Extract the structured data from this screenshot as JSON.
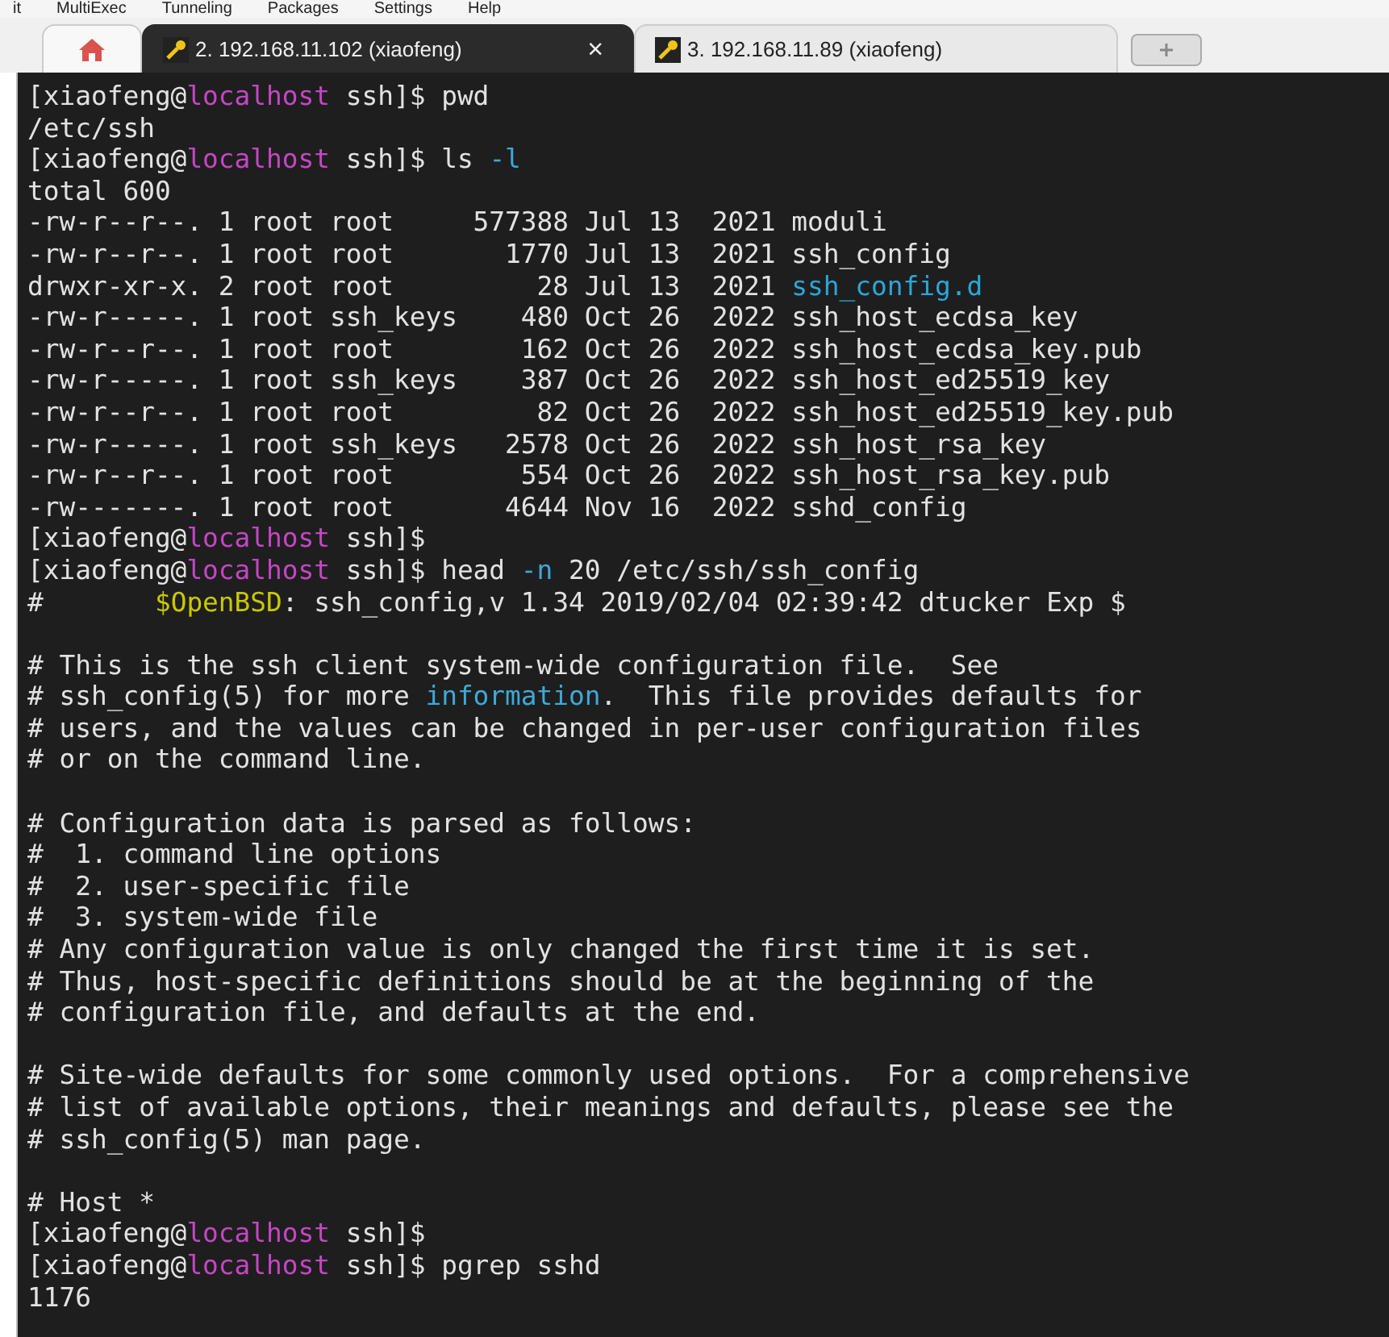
{
  "menu": [
    "it",
    "MultiExec",
    "Tunneling",
    "Packages",
    "Settings",
    "Help"
  ],
  "tabs": [
    {
      "kind": "home",
      "selected": false
    },
    {
      "kind": "session",
      "label": "2. 192.168.11.102 (xiaofeng)",
      "selected": true,
      "close": "×"
    },
    {
      "kind": "session",
      "label": "3. 192.168.11.89 (xiaofeng)",
      "selected": false
    },
    {
      "kind": "new",
      "selected": false
    }
  ],
  "terminal": {
    "lines": [
      {
        "segments": [
          {
            "text": "[xiaofeng@"
          },
          {
            "text": "localhost",
            "color": "#c546c5"
          },
          {
            "text": " ssh]$ pwd"
          }
        ]
      },
      {
        "segments": [
          {
            "text": "/etc/ssh"
          }
        ]
      },
      {
        "segments": [
          {
            "text": "[xiaofeng@"
          },
          {
            "text": "localhost",
            "color": "#c546c5"
          },
          {
            "text": " ssh]$ ls "
          },
          {
            "text": "-l",
            "color": "#3ea9d8"
          }
        ]
      },
      {
        "segments": [
          {
            "text": "total 600"
          }
        ]
      },
      {
        "segments": [
          {
            "text": "-rw-r--r--. 1 root root     577388 Jul 13  2021 moduli"
          }
        ]
      },
      {
        "segments": [
          {
            "text": "-rw-r--r--. 1 root root       1770 Jul 13  2021 ssh_config"
          }
        ]
      },
      {
        "segments": [
          {
            "text": "drwxr-xr-x. 2 root root         28 Jul 13  2021 "
          },
          {
            "text": "ssh_config.d",
            "color": "#2aa7d8"
          }
        ]
      },
      {
        "segments": [
          {
            "text": "-rw-r-----. 1 root ssh_keys    480 Oct 26  2022 ssh_host_ecdsa_key"
          }
        ]
      },
      {
        "segments": [
          {
            "text": "-rw-r--r--. 1 root root        162 Oct 26  2022 ssh_host_ecdsa_key.pub"
          }
        ]
      },
      {
        "segments": [
          {
            "text": "-rw-r-----. 1 root ssh_keys    387 Oct 26  2022 ssh_host_ed25519_key"
          }
        ]
      },
      {
        "segments": [
          {
            "text": "-rw-r--r--. 1 root root         82 Oct 26  2022 ssh_host_ed25519_key.pub"
          }
        ]
      },
      {
        "segments": [
          {
            "text": "-rw-r-----. 1 root ssh_keys   2578 Oct 26  2022 ssh_host_rsa_key"
          }
        ]
      },
      {
        "segments": [
          {
            "text": "-rw-r--r--. 1 root root        554 Oct 26  2022 ssh_host_rsa_key.pub"
          }
        ]
      },
      {
        "segments": [
          {
            "text": "-rw-------. 1 root root       4644 Nov 16  2022 sshd_config"
          }
        ]
      },
      {
        "segments": [
          {
            "text": "[xiaofeng@"
          },
          {
            "text": "localhost",
            "color": "#c546c5"
          },
          {
            "text": " ssh]$"
          }
        ]
      },
      {
        "segments": [
          {
            "text": "[xiaofeng@"
          },
          {
            "text": "localhost",
            "color": "#c546c5"
          },
          {
            "text": " ssh]$ head "
          },
          {
            "text": "-n",
            "color": "#3ea9d8"
          },
          {
            "text": " 20 /etc/ssh/ssh_config"
          }
        ]
      },
      {
        "segments": [
          {
            "text": "#       "
          },
          {
            "text": "$OpenBSD",
            "color": "#c8c800"
          },
          {
            "text": ": ssh_config,v 1.34 2019/02/04 02:39:42 dtucker Exp $"
          }
        ]
      },
      {
        "kind": "blank"
      },
      {
        "segments": [
          {
            "text": "# This is the ssh client system-wide configuration file.  See"
          }
        ]
      },
      {
        "segments": [
          {
            "text": "# ssh_config(5) for more "
          },
          {
            "text": "information",
            "color": "#3ea9d8"
          },
          {
            "text": ".  This file provides defaults for"
          }
        ]
      },
      {
        "segments": [
          {
            "text": "# users, and the values can be changed in per-user configuration files"
          }
        ]
      },
      {
        "segments": [
          {
            "text": "# or on the command line."
          }
        ]
      },
      {
        "kind": "blank"
      },
      {
        "segments": [
          {
            "text": "# Configuration data is parsed as follows:"
          }
        ]
      },
      {
        "segments": [
          {
            "text": "#  1. command line options"
          }
        ]
      },
      {
        "segments": [
          {
            "text": "#  2. user-specific file"
          }
        ]
      },
      {
        "segments": [
          {
            "text": "#  3. system-wide file"
          }
        ]
      },
      {
        "segments": [
          {
            "text": "# Any configuration value is only changed the first time it is set."
          }
        ]
      },
      {
        "segments": [
          {
            "text": "# Thus, host-specific definitions should be at the beginning of the"
          }
        ]
      },
      {
        "segments": [
          {
            "text": "# configuration file, and defaults at the end."
          }
        ]
      },
      {
        "kind": "blank"
      },
      {
        "segments": [
          {
            "text": "# Site-wide defaults for some commonly used options.  For a comprehensive"
          }
        ]
      },
      {
        "segments": [
          {
            "text": "# list of available options, their meanings and defaults, please see the"
          }
        ]
      },
      {
        "segments": [
          {
            "text": "# ssh_config(5) man page."
          }
        ]
      },
      {
        "kind": "blank"
      },
      {
        "segments": [
          {
            "text": "# Host *"
          }
        ]
      },
      {
        "segments": [
          {
            "text": "[xiaofeng@"
          },
          {
            "text": "localhost",
            "color": "#c546c5"
          },
          {
            "text": " ssh]$"
          }
        ]
      },
      {
        "segments": [
          {
            "text": "[xiaofeng@"
          },
          {
            "text": "localhost",
            "color": "#c546c5"
          },
          {
            "text": " ssh]$ pgrep sshd"
          }
        ]
      },
      {
        "segments": [
          {
            "text": "1176"
          }
        ]
      }
    ]
  }
}
